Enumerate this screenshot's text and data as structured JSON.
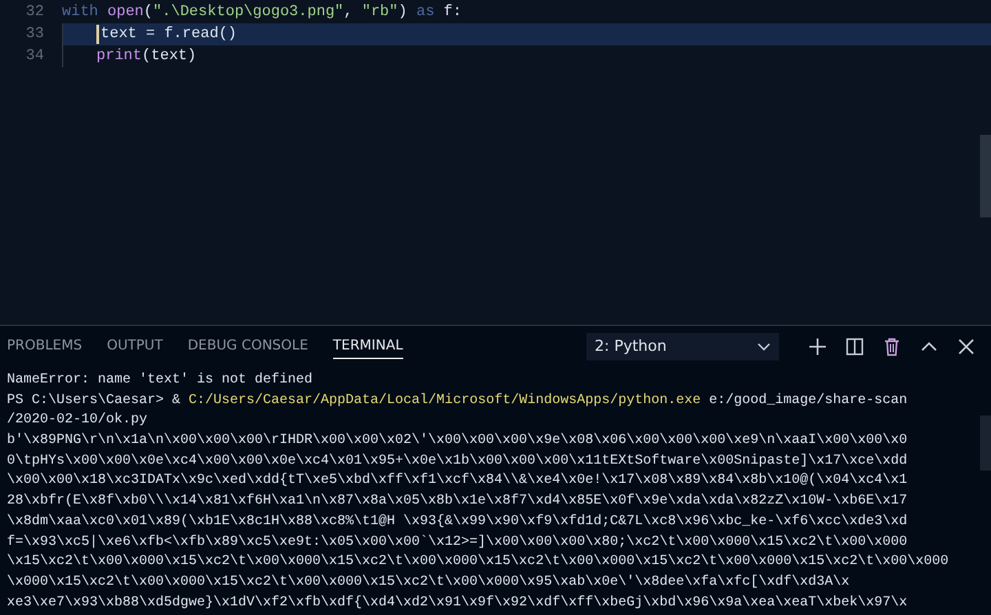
{
  "editor": {
    "lines": [
      {
        "number": "32",
        "selected": false,
        "tokens": [
          {
            "text": "with",
            "kind": "keyword"
          },
          {
            "text": " open",
            "kind": "function"
          },
          {
            "text": "(",
            "kind": "plain"
          },
          {
            "text": "\".\\Desktop\\gogo3.png\"",
            "kind": "string"
          },
          {
            "text": ", ",
            "kind": "plain"
          },
          {
            "text": "\"rb\"",
            "kind": "string"
          },
          {
            "text": ") ",
            "kind": "plain"
          },
          {
            "text": "as",
            "kind": "keyword"
          },
          {
            "text": " f:",
            "kind": "plain"
          }
        ],
        "children": [
          {
            "number": "33",
            "selected": true,
            "tokens": [
              {
                "text": "text = f.read()",
                "kind": "plain"
              }
            ]
          },
          {
            "number": "34",
            "selected": false,
            "tokens": [
              {
                "text": "print",
                "kind": "function"
              },
              {
                "text": "(text)",
                "kind": "plain"
              }
            ]
          }
        ]
      }
    ]
  },
  "panel": {
    "tabs": [
      {
        "label": "PROBLEMS",
        "selected": false
      },
      {
        "label": "OUTPUT",
        "selected": false
      },
      {
        "label": "DEBUG CONSOLE",
        "selected": false
      },
      {
        "label": "TERMINAL",
        "selected": true
      }
    ],
    "terminal_select": {
      "value": "2: Python"
    },
    "terminal": [
      [
        {
          "text": "NameError: name 'text' is not defined",
          "kind": "plain"
        }
      ],
      [
        {
          "text": "PS C:\\Users\\Caesar> & ",
          "kind": "plain"
        },
        {
          "text": "C:/Users/Caesar/AppData/Local/Microsoft/WindowsApps/python.exe",
          "kind": "command"
        },
        {
          "text": " e:/good_image/share-scan",
          "kind": "plain"
        }
      ],
      [
        {
          "text": "/2020-02-10/ok.py",
          "kind": "plain"
        }
      ],
      [
        {
          "text": "b'\\x89PNG\\r\\n\\x1a\\n\\x00\\x00\\x00\\rIHDR\\x00\\x00\\x02\\'\\x00\\x00\\x00\\x9e\\x08\\x06\\x00\\x00\\x00\\xe9\\n\\xaaI\\x00\\x00\\x0",
          "kind": "plain"
        }
      ],
      [
        {
          "text": "0\\tpHYs\\x00\\x00\\x0e\\xc4\\x00\\x00\\x0e\\xc4\\x01\\x95+\\x0e\\x1b\\x00\\x00\\x00\\x11tEXtSoftware\\x00Snipaste]\\x17\\xce\\xdd",
          "kind": "plain"
        }
      ],
      [
        {
          "text": "\\x00\\x00\\x18\\xc3IDATx\\x9c\\xed\\xdd{tT\\xe5\\xbd\\xff\\xf1\\xcf\\x84\\\\&\\xe4\\x0e!\\x17\\x08\\x89\\x84\\x8b\\x10@(\\x04\\xc4\\x1",
          "kind": "plain"
        }
      ],
      [
        {
          "text": "28\\xbfr(E\\x8f\\xb0\\\\\\x14\\x81\\xf6H\\xa1\\n\\x87\\x8a\\x05\\x8b\\x1e\\x8f7\\xd4\\x85E\\x0f\\x9e\\xda\\xda\\x82zZ\\x10W-\\xb6E\\x17",
          "kind": "plain"
        }
      ],
      [
        {
          "text": "\\x8dm\\xaa\\xc0\\x01\\x89(\\xb1E\\x8c1H\\x88\\xc8%\\t1@H \\x93{&\\x99\\x90\\xf9\\xfd1d;C&7L\\xc8\\x96\\xbc_ke-\\xf6\\xcc\\xde3\\xd",
          "kind": "plain"
        }
      ],
      [
        {
          "text": "f=\\x93\\xc5|\\xe6\\xfb<\\xfb\\x89\\xc5\\xe9t:\\x05\\x00\\x00`\\x12>=]\\x00\\x00\\x00\\x80;\\xc2\\t\\x00\\x000\\x15\\xc2\\t\\x00\\x000",
          "kind": "plain"
        }
      ],
      [
        {
          "text": "\\x15\\xc2\\t\\x00\\x000\\x15\\xc2\\t\\x00\\x000\\x15\\xc2\\t\\x00\\x000\\x15\\xc2\\t\\x00\\x000\\x15\\xc2\\t\\x00\\x000\\x15\\xc2\\t\\x00\\x000",
          "kind": "plain"
        }
      ],
      [
        {
          "text": "\\x000\\x15\\xc2\\t\\x00\\x000\\x15\\xc2\\t\\x00\\x000\\x15\\xc2\\t\\x00\\x000\\x95\\xab\\x0e\\'\\x8dee\\xfa\\xfc[\\xdf\\xd3A\\x",
          "kind": "plain"
        }
      ],
      [
        {
          "text": "xe3\\xe7\\x93\\xb88\\xd5dgwe}\\x1dV\\xf2\\xfb\\xdf{\\xd4\\xd2\\x91\\x9f\\x92\\xdf\\xff\\xbeGj\\xbd\\x96\\x9a\\xea\\xeaT\\xbek\\x97\\x",
          "kind": "plain"
        }
      ]
    ]
  }
}
